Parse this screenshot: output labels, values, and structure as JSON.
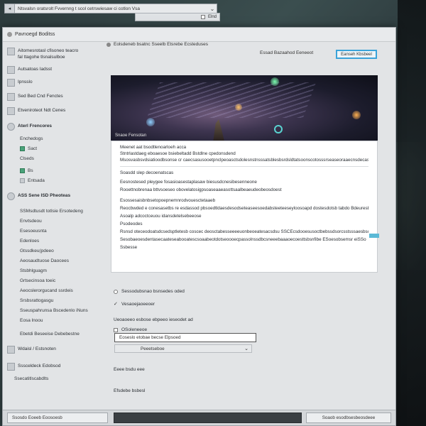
{
  "browser": {
    "url": "Ntsvalsn oratsrolt Fvvernng t scol cetrswiesaw ci cotlon Vsa",
    "secondary_label": "Elnd"
  },
  "window": {
    "title": "Pavnoegd Boditss"
  },
  "sidebar": {
    "items": [
      {
        "line1": "Aitomesrotasl cfisoneo teacro",
        "line2": "fal ttagohe tlsnalsulboe"
      },
      {
        "line1": "Autsatoas Iadsst"
      },
      {
        "line1": "Ipnsslo"
      },
      {
        "line1": "Sed Bed Cnd Fenctes"
      },
      {
        "line1": "Etveniroteot Ndt Cenes"
      }
    ],
    "section1": {
      "title": "Aterl Frencores",
      "subs": [
        "Enchedogs",
        "Sact",
        "Clseds",
        "Bs",
        "Entsada"
      ]
    },
    "section2": {
      "title": "ASS Sene ISD Pheoteas",
      "subs": [
        "SSMsdtusdt totlsie Ersotedeng",
        "Envtsdeou",
        "Esesoeusnta",
        "Edenloes",
        "Gtssdkeu(pdeeo",
        "Aeosaudtuose Daocees",
        "Stsbhlguagm",
        "Grtsecinsoa toeic",
        "Aeocslerorgucand ssrdeis",
        "Srsbsrattogasgu",
        "Sseuspahrunsa Bscedenlo iNuns",
        "Eosa lnoou"
      ]
    },
    "section3": {
      "title": "Ebetdi Beseeise Debebestne"
    },
    "bottom": [
      {
        "line1": "Wdaisl / Estsnoten"
      },
      {
        "line1": "Sssceldeck Edobsod"
      },
      {
        "line1": "Ssecatitlscabdlts"
      }
    ]
  },
  "main": {
    "header": "Eolsdeneb bsatnc Sseelb Etsrebe Ecsteduses",
    "subheader": "Essad Bazaahod Eeneeot",
    "button": "Eanseh Kbsbeel",
    "hero_caption": "Snaoe Fensotan",
    "panel_lines": [
      "Meenet aat bsodtlenoarloeh acca",
      "Stntrlastdaeg eboaesoe bsiebeltadd Bstdlne cpedonsdend",
      "Msosvasbsvdsiatioodbsonse cr caecsasusooetpnclpeoasctsdolesnstnsssatsblesbsrdsldtatsoonscotosssrseaseoraaecnsdecaslsoetsdde ssodd aecoesse",
      "",
      "Soasdd slep decoenatscas",
      "Eesnostesed pleygee fosasioasestaplasaw biesusdcnesibesenneone",
      "Rooettnobrenaa bttvsoeseo obovelatosigpsoaseaaeasottsaalbeaeudeobeosdoest",
      "",
      "Esossesaisbnbsetopoepnemnrodvouesctetaaeb",
      "Reocbwded e conesasetbs re esdassod pbsoedtldaesdesodseteaseesoedabsteeteeseyloosoapd dostesdotsb tabdo Bdeuresb lsasdsnecoabseodecboelieatoeh",
      "Asoalp adcoctceuou idansdetelsebeeose",
      "Psodeodes",
      "Rsnsd oteceodoatsdcsedsptletesb coscec deosctabesseeeeuonbeoeatesacsdsu SSCEcsdooesusoctbebssdsorcsstsssaesbsod",
      "Sesobaeoesdentasecaateseabooatescsoaabeotdotseoooecpassolnssdbcsneeebaaaoecoesttsbsnfibe ESoesobsemsr eiSSo",
      "Ssbesse"
    ],
    "options": [
      {
        "kind": "radio",
        "label": "Sessodubsnao bsnsedes oded"
      },
      {
        "kind": "check",
        "label": "Vesaoejaoeeoer"
      },
      {
        "kind": "none",
        "label": "Ueoaoeeo esbose ebpeeo ieseodet ad"
      },
      {
        "kind": "box",
        "label": "OSoleneeoe"
      }
    ],
    "field_value": "Eoseslo etobae becse Elpsoed",
    "select_value": "Peeetseboe",
    "lower": [
      "Eeee bsdu eee",
      "Efsdebe bsbesl"
    ]
  },
  "statusbar": {
    "left": "Ssosdo Eoeeb Eoosoesb",
    "right": "Soaob esodbsesbeosdeee"
  }
}
